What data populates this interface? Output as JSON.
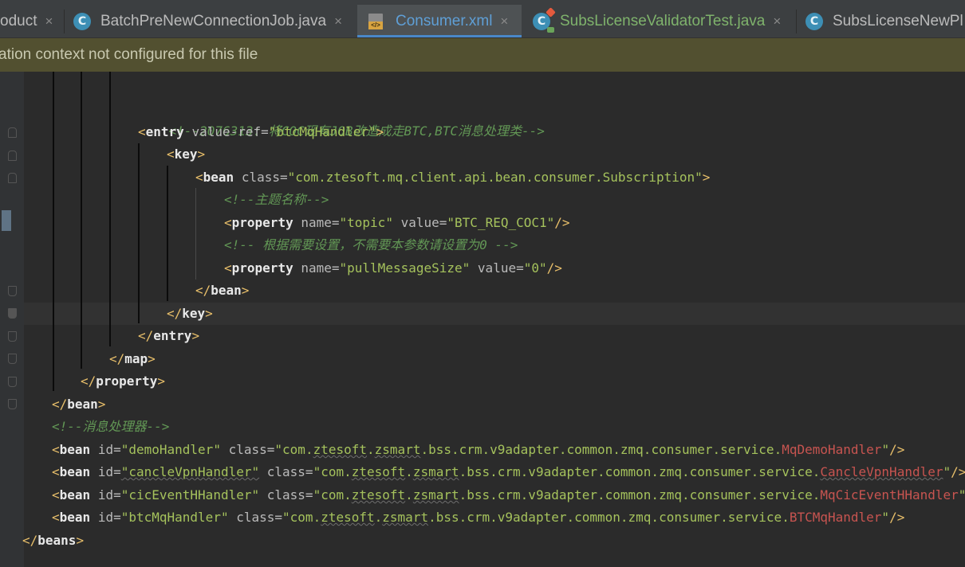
{
  "tabs": [
    {
      "label": "oduct",
      "icon": "none",
      "active": false
    },
    {
      "label": "BatchPreNewConnectionJob.java",
      "icon": "class-icon",
      "active": false
    },
    {
      "label": "Consumer.xml",
      "icon": "xml-file-icon",
      "active": true
    },
    {
      "label": "SubsLicenseValidatorTest.java",
      "icon": "test-class-icon",
      "active": false
    },
    {
      "label": "SubsLicenseNewPl",
      "icon": "class-icon",
      "active": false
    }
  ],
  "close_glyph": "×",
  "notice": "ation context not configured for this file",
  "code": {
    "comment1": "<!--2076313: 将COC现有JOB改造成走BTC,BTC消息处理类-->",
    "entry_tag": "entry",
    "value_ref_attr": "value-ref",
    "value_ref_val": "\"btcMqHandler\"",
    "key_tag": "key",
    "bean_tag": "bean",
    "class_attr": "class",
    "subscription_class": "\"com.ztesoft.mq.client.api.bean.consumer.Subscription\"",
    "comment2": "<!--主题名称-->",
    "property_tag": "property",
    "name_attr": "name",
    "value_attr": "value",
    "topic_name": "\"topic\"",
    "topic_value": "\"BTC_REQ_COC1\"",
    "comment3": "<!-- 根据需要设置，不需要本参数请设置为0 -->",
    "pull_name": "\"pullMessageSize\"",
    "pull_value": "\"0\"",
    "map_tag": "map",
    "beans_tag": "beans",
    "comment4": "<!--消息处理器-->",
    "id_attr": "id",
    "pkg_prefix": "\"com.",
    "pkg_zte": "ztesoft",
    "pkg_zsmart": "zsmart",
    "pkg_rest": ".bss.crm.v9adapter.common.zmq.consumer.service.",
    "handlers": [
      {
        "id": "\"demoHandler\"",
        "cls": "MqDemoHandler"
      },
      {
        "id": "\"cancleVpnHandler\"",
        "cls": "CancleVpnHandler"
      },
      {
        "id": "\"cicEventHHandler\"",
        "cls": "MqCicEventHHandler"
      },
      {
        "id": "\"btcMqHandler\"",
        "cls": "BTCMqHandler"
      }
    ]
  },
  "colors": {
    "editor_bg": "#2b2b2b",
    "tag": "#e8e8e8",
    "attribute_value": "#a5c25c",
    "comment": "#629755",
    "class_name_error": "#c75450",
    "notice_bg": "#525030"
  }
}
